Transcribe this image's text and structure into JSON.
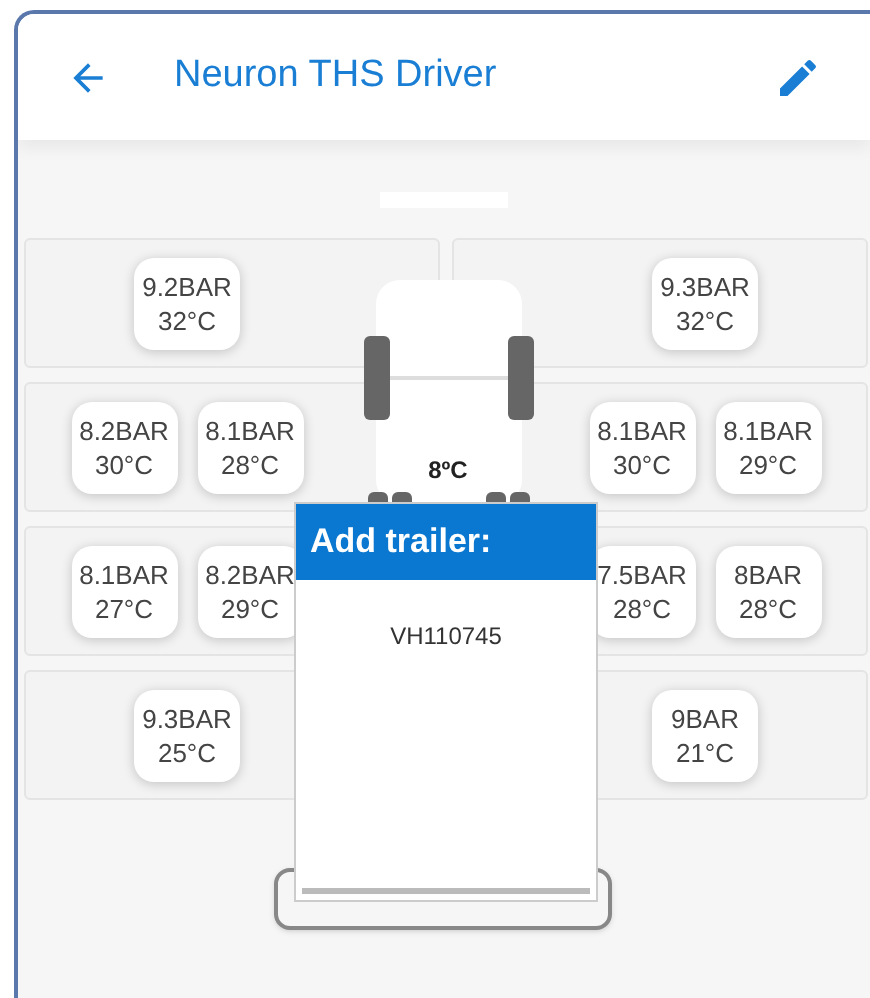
{
  "header": {
    "title": "Neuron THS Driver"
  },
  "axles": [
    {
      "left": [
        {
          "pressure": "9.2BAR",
          "temp": "32°C"
        }
      ],
      "right": [
        {
          "pressure": "9.3BAR",
          "temp": "32°C"
        }
      ]
    },
    {
      "left": [
        {
          "pressure": "8.2BAR",
          "temp": "30°C"
        },
        {
          "pressure": "8.1BAR",
          "temp": "28°C"
        }
      ],
      "right": [
        {
          "pressure": "8.1BAR",
          "temp": "30°C"
        },
        {
          "pressure": "8.1BAR",
          "temp": "29°C"
        }
      ]
    },
    {
      "left": [
        {
          "pressure": "8.1BAR",
          "temp": "27°C"
        },
        {
          "pressure": "8.2BAR",
          "temp": "29°C"
        }
      ],
      "right": [
        {
          "pressure": "7.5BAR",
          "temp": "28°C"
        },
        {
          "pressure": "8BAR",
          "temp": "28°C"
        }
      ]
    },
    {
      "left": [
        {
          "pressure": "9.3BAR",
          "temp": "25°C"
        }
      ],
      "right": [
        {
          "pressure": "9BAR",
          "temp": "21°C"
        }
      ]
    }
  ],
  "truck": {
    "temperature": "8ºC"
  },
  "dialog": {
    "title": "Add trailer:",
    "items": [
      "VH110745"
    ]
  }
}
